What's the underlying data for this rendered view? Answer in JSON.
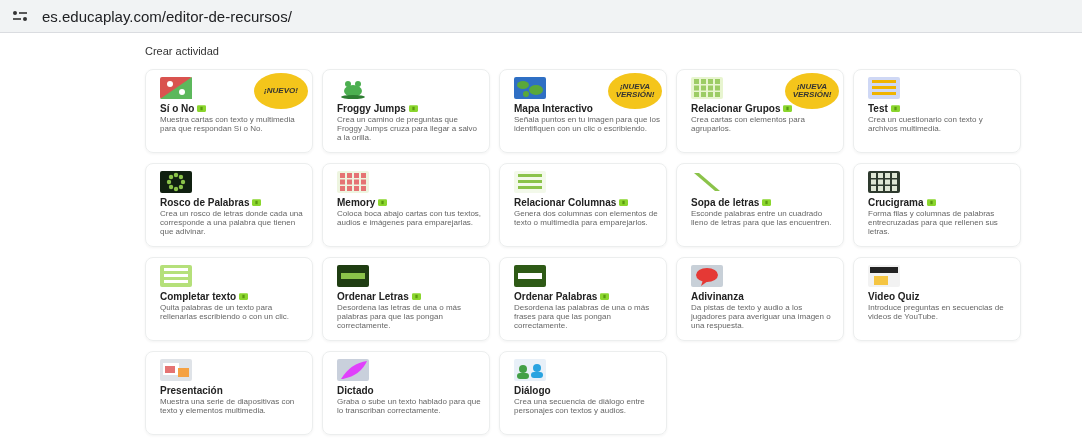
{
  "address_bar": {
    "url": "es.educaplay.com/editor-de-recursos/"
  },
  "heading": "Crear actividad",
  "activities": [
    {
      "title": "Sí o No",
      "description": "Muestra cartas con texto y multimedia para que respondan Sí o No.",
      "badge": true,
      "ribbon": "¡NUEVO!"
    },
    {
      "title": "Froggy Jumps",
      "description": "Crea un camino de preguntas que Froggy Jumps cruza para llegar a salvo a la orilla.",
      "badge": true
    },
    {
      "title": "Mapa Interactivo",
      "description": "Señala puntos en tu imagen para que los identifiquen con un clic o escribiendo.",
      "badge": false,
      "ribbon": "¡NUEVA VERSIÓN!"
    },
    {
      "title": "Relacionar Grupos",
      "description": "Crea cartas con elementos para agruparlos.",
      "badge": true,
      "ribbon": "¡NUEVA VERSIÓN!"
    },
    {
      "title": "Test",
      "description": "Crea un cuestionario con texto y archivos multimedia.",
      "badge": true
    },
    {
      "title": "Rosco de Palabras",
      "description": "Crea un rosco de letras donde cada una corresponde a una palabra que tienen que adivinar.",
      "badge": true
    },
    {
      "title": "Memory",
      "description": "Coloca boca abajo cartas con tus textos, audios e imágenes para emparejarlas.",
      "badge": true
    },
    {
      "title": "Relacionar Columnas",
      "description": "Genera dos columnas con elementos de texto o multimedia para emparejarlos.",
      "badge": true
    },
    {
      "title": "Sopa de letras",
      "description": "Esconde palabras entre un cuadrado lleno de letras para que las encuentren.",
      "badge": true
    },
    {
      "title": "Crucigrama",
      "description": "Forma filas y columnas de palabras entrecruzadas para que rellenen sus letras.",
      "badge": true
    },
    {
      "title": "Completar texto",
      "description": "Quita palabras de un texto para rellenarlas escribiendo o con un clic.",
      "badge": true
    },
    {
      "title": "Ordenar Letras",
      "description": "Desordena las letras de una o más palabras para que las pongan correctamente.",
      "badge": true
    },
    {
      "title": "Ordenar Palabras",
      "description": "Desordena las palabras de una o más frases para que las pongan correctamente.",
      "badge": true
    },
    {
      "title": "Adivinanza",
      "description": "Da pistas de texto y audio a los jugadores para averiguar una imagen o una respuesta.",
      "badge": false
    },
    {
      "title": "Video Quiz",
      "description": "Introduce preguntas en secuencias de videos de YouTube.",
      "badge": false
    },
    {
      "title": "Presentación",
      "description": "Muestra una serie de diapositivas con texto y elementos multimedia.",
      "badge": false
    },
    {
      "title": "Dictado",
      "description": "Graba o sube un texto hablado para que lo transcriban correctamente.",
      "badge": false
    },
    {
      "title": "Diálogo",
      "description": "Crea una secuencia de diálogo entre personajes con textos y audios.",
      "badge": false
    }
  ]
}
